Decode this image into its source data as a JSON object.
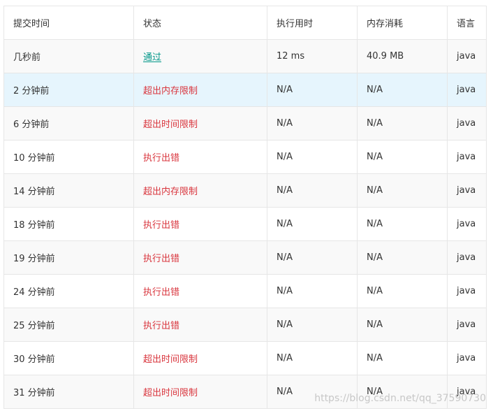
{
  "table": {
    "headers": [
      "提交时间",
      "状态",
      "执行用时",
      "内存消耗",
      "语言"
    ],
    "rows": [
      {
        "time": "几秒前",
        "status": "通过",
        "status_type": "pass",
        "runtime": "12 ms",
        "memory": "40.9 MB",
        "lang": "java"
      },
      {
        "time": "2 分钟前",
        "status": "超出内存限制",
        "status_type": "fail",
        "runtime": "N/A",
        "memory": "N/A",
        "lang": "java",
        "highlighted": true
      },
      {
        "time": "6 分钟前",
        "status": "超出时间限制",
        "status_type": "fail",
        "runtime": "N/A",
        "memory": "N/A",
        "lang": "java"
      },
      {
        "time": "10 分钟前",
        "status": "执行出错",
        "status_type": "fail",
        "runtime": "N/A",
        "memory": "N/A",
        "lang": "java"
      },
      {
        "time": "14 分钟前",
        "status": "超出内存限制",
        "status_type": "fail",
        "runtime": "N/A",
        "memory": "N/A",
        "lang": "java"
      },
      {
        "time": "18 分钟前",
        "status": "执行出错",
        "status_type": "fail",
        "runtime": "N/A",
        "memory": "N/A",
        "lang": "java"
      },
      {
        "time": "19 分钟前",
        "status": "执行出错",
        "status_type": "fail",
        "runtime": "N/A",
        "memory": "N/A",
        "lang": "java"
      },
      {
        "time": "24 分钟前",
        "status": "执行出错",
        "status_type": "fail",
        "runtime": "N/A",
        "memory": "N/A",
        "lang": "java"
      },
      {
        "time": "25 分钟前",
        "status": "执行出错",
        "status_type": "fail",
        "runtime": "N/A",
        "memory": "N/A",
        "lang": "java"
      },
      {
        "time": "30 分钟前",
        "status": "超出时间限制",
        "status_type": "fail",
        "runtime": "N/A",
        "memory": "N/A",
        "lang": "java"
      },
      {
        "time": "31 分钟前",
        "status": "超出时间限制",
        "status_type": "fail",
        "runtime": "N/A",
        "memory": "N/A",
        "lang": "java"
      }
    ]
  },
  "colors": {
    "pass": "#009688",
    "fail": "#d9363e",
    "highlight_row": "#e6f5fd"
  },
  "watermark": "https://blog.csdn.net/qq_37590730"
}
